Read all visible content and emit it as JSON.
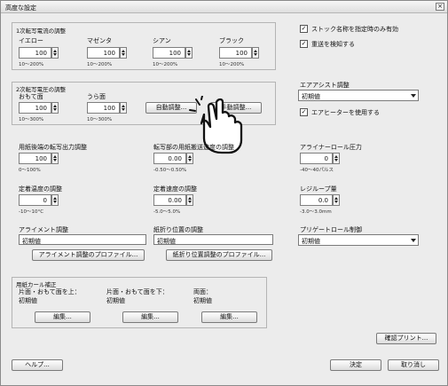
{
  "window": {
    "title": "高度な設定",
    "close": "×"
  },
  "groups": {
    "transfer_current": {
      "title": "1次転写電流の調整",
      "items": [
        {
          "label": "イエロー",
          "value": "100",
          "range": "10～200%"
        },
        {
          "label": "マゼンタ",
          "value": "100",
          "range": "10～200%"
        },
        {
          "label": "シアン",
          "value": "100",
          "range": "10～200%"
        },
        {
          "label": "ブラック",
          "value": "100",
          "range": "10～200%"
        }
      ]
    },
    "transfer_voltage": {
      "title": "2次転写電圧の調整",
      "front": {
        "label": "おもて面",
        "value": "100",
        "range": "10～300%"
      },
      "back": {
        "label": "うら面",
        "value": "100",
        "range": "10～300%"
      },
      "auto_button": "自動調整...",
      "manual_button": "手動調整..."
    }
  },
  "settings": {
    "output_adjust": {
      "label": "用紙後端の転写出力調整",
      "value": "100",
      "range": "0～100%"
    },
    "speed_adjust": {
      "label": "転写部の用紙搬送速度の調整",
      "value": "0.00",
      "range": "-0.50～0.50%"
    },
    "aligner_pressure": {
      "label": "アライナーロール圧力",
      "value": "0",
      "range": "-40～40パルス"
    },
    "fix_temp": {
      "label": "定着温度の調整",
      "value": "0",
      "range": "-10～10°C"
    },
    "fix_speed": {
      "label": "定着速度の調整",
      "value": "0.00",
      "range": "-5.0～5.0%"
    },
    "registration_loop": {
      "label": "レジループ量",
      "value": "0.0",
      "range": "-3.0～3.0mm"
    }
  },
  "right_panel": {
    "check_stock_name": "ストック名称を指定時のみ有効",
    "check_multifeed": "重送を検知する",
    "air_assist_label": "エアアシスト調整",
    "air_assist_value": "初期値",
    "check_air_heater": "エアヒーターを使用する",
    "preregist_label": "プリゲートロール制御",
    "preregist_value": "初期値"
  },
  "alignment": {
    "label": "アライメント調整",
    "value": "初期値",
    "button": "アライメント調整のプロファイル..."
  },
  "fold": {
    "label": "紙折り位置の調整",
    "value": "初期値",
    "button": "紙折り位置調整のプロファイル..."
  },
  "curl": {
    "title": "用紙カール補正",
    "items": [
      {
        "label": "片面・おもて面を上：",
        "value": "初期値",
        "button": "編集..."
      },
      {
        "label": "片面・おもて面を下：",
        "value": "初期値",
        "button": "編集..."
      },
      {
        "label": "両面：",
        "value": "初期値",
        "button": "編集..."
      }
    ]
  },
  "buttons": {
    "confirm_print": "確認プリント...",
    "help": "ヘルプ...",
    "ok": "決定",
    "cancel": "取り消し"
  }
}
